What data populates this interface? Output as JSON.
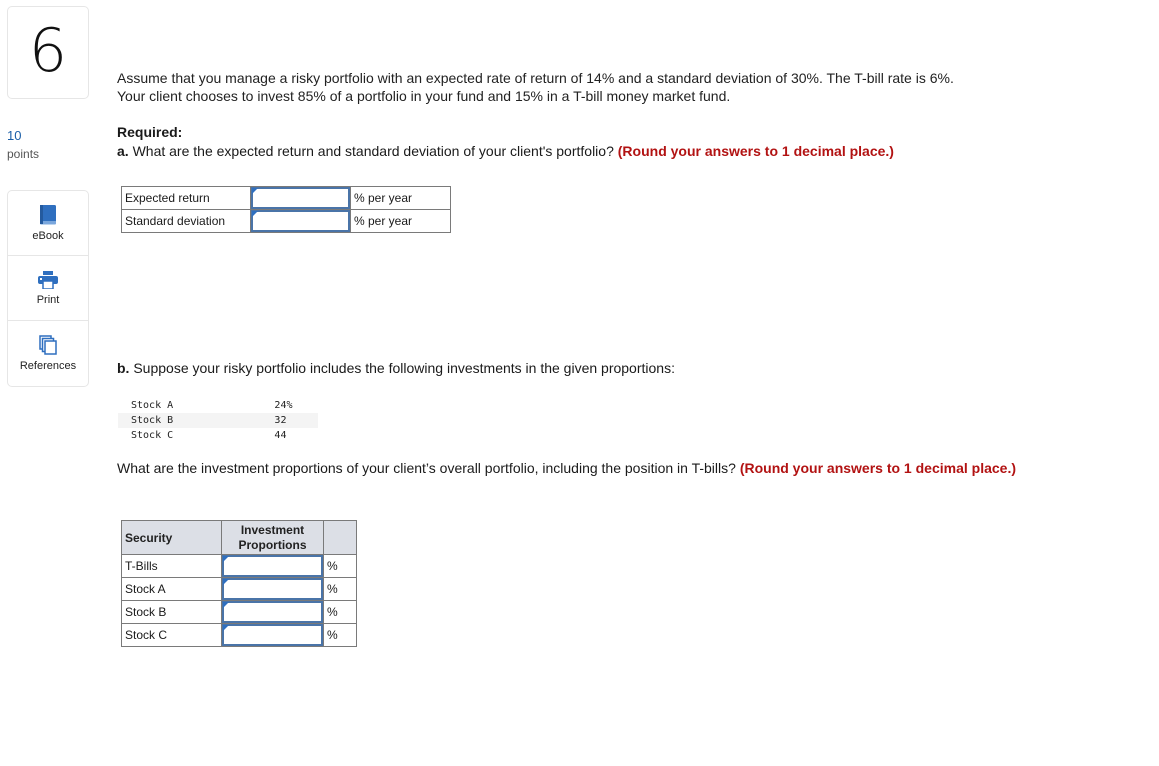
{
  "question": {
    "number": "6",
    "points_value": "10",
    "points_label": "points"
  },
  "tools": [
    {
      "label": "eBook",
      "icon": "book-icon"
    },
    {
      "label": "Print",
      "icon": "printer-icon"
    },
    {
      "label": "References",
      "icon": "references-icon"
    }
  ],
  "intro": {
    "line1": "Assume that you manage a risky portfolio with an expected rate of return of 14% and a standard deviation of 30%. The T-bill rate is 6%.",
    "line2": "Your client chooses to invest 85% of a portfolio in your fund and 15% in a T-bill money market fund."
  },
  "required_label": "Required:",
  "part_a": {
    "lead": "a.",
    "question": " What are the expected return and standard deviation of your client's portfolio? ",
    "instruction": "(Round your answers to 1 decimal place.)",
    "rows": [
      {
        "label": "Expected return",
        "value": "",
        "unit": "% per year"
      },
      {
        "label": "Standard deviation",
        "value": "",
        "unit": "% per year"
      }
    ]
  },
  "part_b": {
    "lead": "b.",
    "question": " Suppose your risky portfolio includes the following investments in the given proportions:",
    "holdings": [
      {
        "name": "Stock A",
        "value": "24%"
      },
      {
        "name": "Stock B",
        "value": "32"
      },
      {
        "name": "Stock C",
        "value": "44"
      }
    ],
    "followup": "What are the investment proportions of your client’s overall portfolio, including the position in T-bills? ",
    "instruction": "(Round your answers to 1 decimal place.)",
    "table": {
      "headers": {
        "security": "Security",
        "proportions_line1": "Investment",
        "proportions_line2": "Proportions"
      },
      "rows": [
        {
          "security": "T-Bills",
          "value": "",
          "unit": "%"
        },
        {
          "security": "Stock A",
          "value": "",
          "unit": "%"
        },
        {
          "security": "Stock B",
          "value": "",
          "unit": "%"
        },
        {
          "security": "Stock C",
          "value": "",
          "unit": "%"
        }
      ]
    }
  },
  "colors": {
    "accent": "#1a5ea8",
    "instruction_red": "#b21212",
    "input_border": "#4a74a8",
    "header_bg": "#dcdfe6"
  }
}
